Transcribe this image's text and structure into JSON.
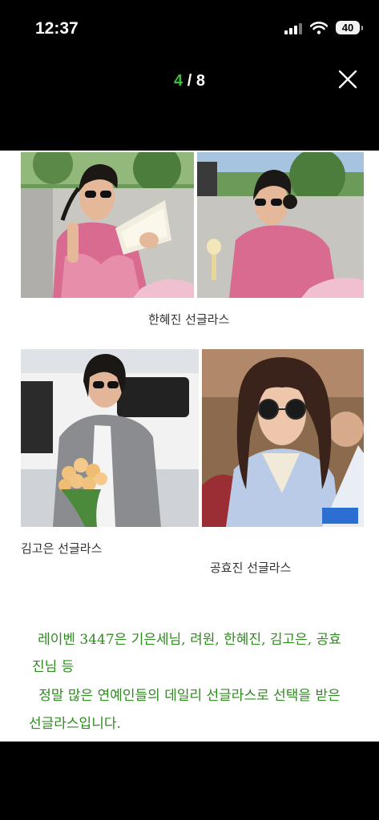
{
  "status_bar": {
    "time": "12:37",
    "battery": "40",
    "icons": [
      "cellular-signal-icon",
      "wifi-icon",
      "battery-icon"
    ]
  },
  "viewer": {
    "current": "4",
    "separator": " / ",
    "total": "8",
    "close_icon": "close-icon"
  },
  "captions": {
    "top": "한혜진 선글라스",
    "left": "김고은 선글라스",
    "right": "공효진 선글라스"
  },
  "description": {
    "line1": "레이벤 3447은 기은세님, 려원, 한혜진, 김고은, 공효",
    "line2": "진님 등",
    "line3": "정말 많은 연예인들의 데일리 선글라스로 선택을 받은",
    "line4": "선글라스입니다."
  },
  "colors": {
    "accent": "#3bbf3b",
    "handwriting": "#2e8b1e",
    "background": "#000000"
  }
}
